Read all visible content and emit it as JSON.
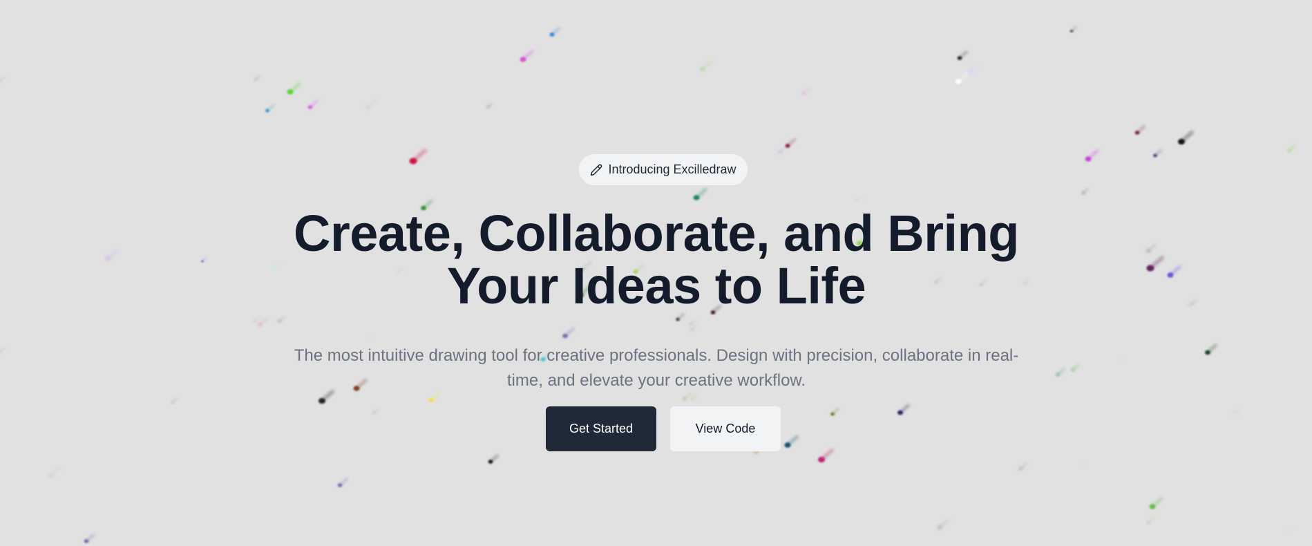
{
  "hero": {
    "badge": {
      "icon": "pencil-icon",
      "label": "Introducing Excilledraw"
    },
    "headline_line1": "Create, Collaborate, and Bring",
    "headline_line2": "Your Ideas to Life",
    "subtitle_line1": "The most intuitive drawing tool for creative professionals. Design with precision, collaborate in real-",
    "subtitle_line2": "time, and elevate your creative workflow.",
    "primary_cta": "Get Started",
    "secondary_cta": "View Code"
  },
  "colors": {
    "background": "#e1e1e1",
    "headline": "#141b2b",
    "subtitle": "#6b7280",
    "primary_button": "#1f2937",
    "secondary_button": "#f2f3f5"
  }
}
